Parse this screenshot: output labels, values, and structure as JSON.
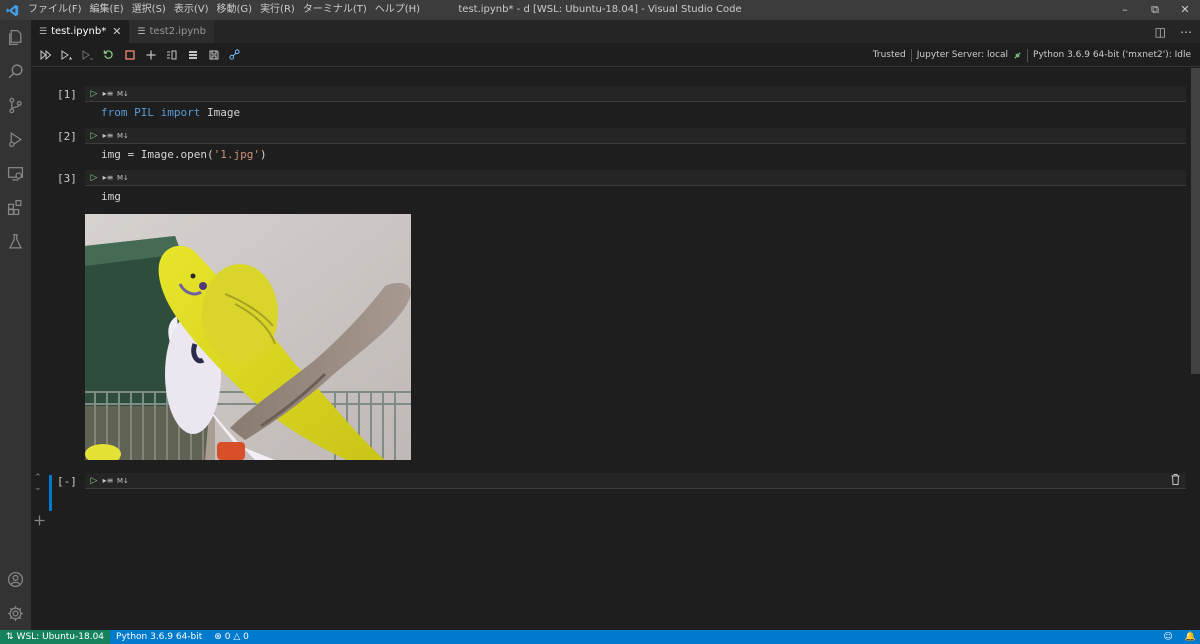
{
  "titlebar": {
    "menu": [
      "ファイル(F)",
      "編集(E)",
      "選択(S)",
      "表示(V)",
      "移動(G)",
      "実行(R)",
      "ターミナル(T)",
      "ヘルプ(H)"
    ],
    "title": "test.ipynb* - d [WSL: Ubuntu-18.04] - Visual Studio Code"
  },
  "tabs": [
    {
      "label": "test.ipynb*",
      "active": true
    },
    {
      "label": "test2.ipynb",
      "active": false
    }
  ],
  "toolbar": {
    "trusted": "Trusted",
    "server": "Jupyter Server: local",
    "kernel": "Python 3.6.9 64-bit ('mxnet2'): Idle"
  },
  "cells": [
    {
      "exec": "[1]",
      "code_parts": [
        "from",
        "PIL",
        "import",
        "Image"
      ]
    },
    {
      "exec": "[2]",
      "code_parts": [
        "img = Image.open(",
        "'1.jpg'",
        ")"
      ]
    },
    {
      "exec": "[3]",
      "code_parts": [
        "img"
      ]
    },
    {
      "exec": "[-]"
    }
  ],
  "cell_toolbar": {
    "md_label": "M↓"
  },
  "statusbar": {
    "remote": "WSL: Ubuntu-18.04",
    "python": "Python 3.6.9 64-bit",
    "errors": "0",
    "warnings": "0"
  },
  "colors": {
    "accent": "#007acc",
    "remote_bg": "#16825d",
    "keyword": "#569cd6",
    "string": "#ce9178",
    "run_green": "#89d185",
    "stop_red": "#f48771"
  }
}
